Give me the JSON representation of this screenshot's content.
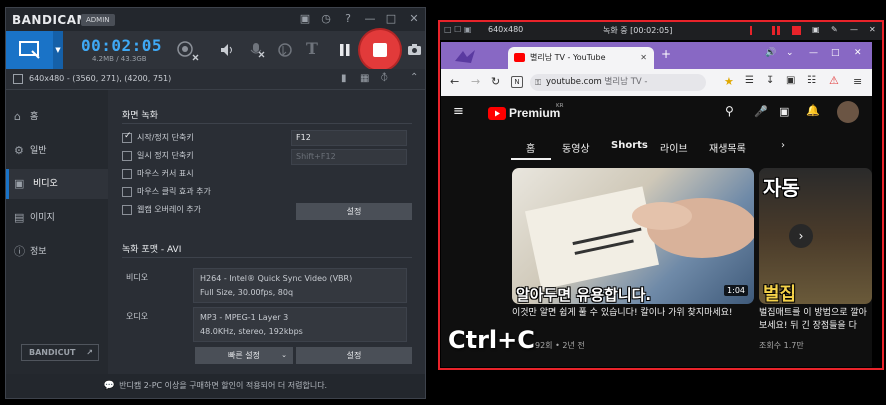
{
  "bandicam": {
    "logo": "BANDICAM",
    "badge": "ADMIN",
    "timer": "00:02:05",
    "size_info": "4.2MB / 43.3GB",
    "region_info": "640x480 - (3560, 271), (4200, 751)",
    "nav": [
      {
        "label": "홈",
        "icon": "home-icon"
      },
      {
        "label": "일반",
        "icon": "gear-icon"
      },
      {
        "label": "비디오",
        "icon": "video-icon"
      },
      {
        "label": "이미지",
        "icon": "image-icon"
      },
      {
        "label": "정보",
        "icon": "info-icon"
      }
    ],
    "bandicut": "BANDICUT",
    "screen_rec": {
      "title": "화면 녹화",
      "options": [
        {
          "label": "시작/정지 단축키",
          "checked": true
        },
        {
          "label": "일시 정지 단축키",
          "checked": false
        },
        {
          "label": "마우스 커서 표시",
          "checked": false
        },
        {
          "label": "마우스 클릭 효과 추가",
          "checked": false
        },
        {
          "label": "웹캠 오버레이 추가",
          "checked": false
        }
      ],
      "hotkey_start": "F12",
      "hotkey_pause": "Shift+F12",
      "settings_btn": "설정"
    },
    "format": {
      "title": "녹화 포맷 - AVI",
      "video_label": "비디오",
      "video_line1": "H264 - Intel® Quick Sync Video (VBR)",
      "video_line2": "Full Size, 30.00fps, 80q",
      "audio_label": "오디오",
      "audio_line1": "MP3 - MPEG-1 Layer 3",
      "audio_line2": "48.0KHz, stereo, 192kbps",
      "quick_btn": "빠른 설정",
      "settings_btn": "설정"
    },
    "footer": "반디캠 2-PC 이상을 구매하면 할인이 적용되어 더 저렴합니다."
  },
  "region": {
    "size": "640x480",
    "status": "녹화 중 [00:02:05]"
  },
  "browser": {
    "tab_title": "별리남 TV - YouTube",
    "url": "youtube.com",
    "url_suffix": "별리남 TV -",
    "brand": "Premium",
    "brand_sup": "KR",
    "tabs": [
      "홈",
      "동영상",
      "Shorts",
      "라이브",
      "재생목록"
    ],
    "videos": [
      {
        "title": "이것만 알면 쉽게 풀 수 있습니다! 칼이나 가위 찾지마세요!",
        "meta": "92회 • 2년 전",
        "duration": "1:04",
        "caption": "알아두면 유용합니다."
      },
      {
        "title": "벌집매트를 이 방법으로 깔아보세요! 뒤 긴 장점들을 다",
        "meta": "조회수 1.7만",
        "caption_top": "자동",
        "caption": "벌집"
      }
    ]
  },
  "overlay_text": "Ctrl+C"
}
